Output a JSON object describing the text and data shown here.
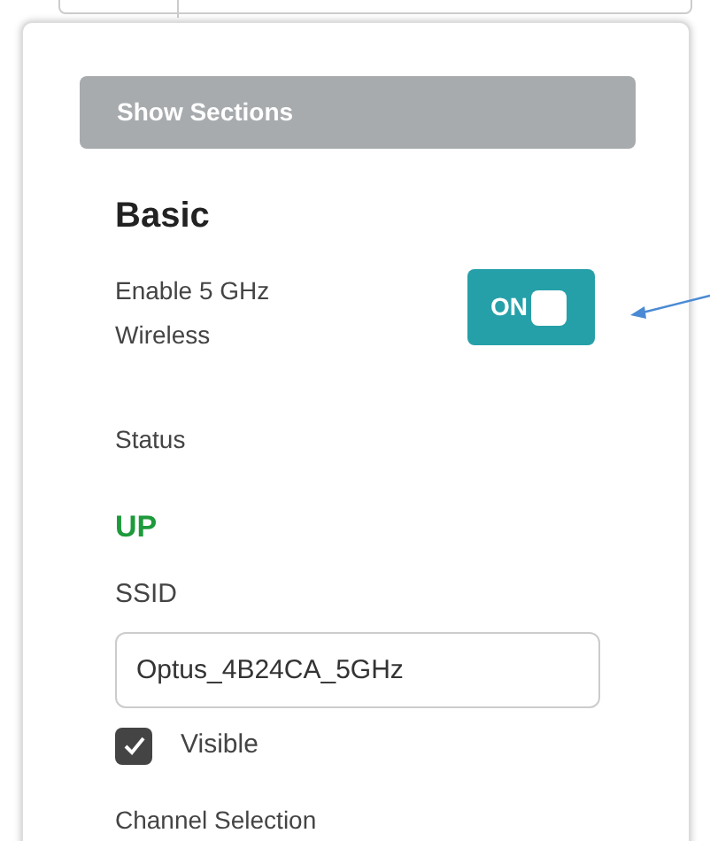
{
  "show_sections_button": {
    "label": "Show Sections"
  },
  "section": {
    "title": "Basic",
    "enable_wireless": {
      "label": "Enable 5 GHz Wireless",
      "toggle_label": "ON",
      "on": true
    },
    "status": {
      "label": "Status",
      "value": "UP"
    },
    "ssid": {
      "label": "SSID",
      "value": "Optus_4B24CA_5GHz"
    },
    "visible": {
      "label": "Visible",
      "checked": true
    },
    "channel_selection": {
      "label": "Channel Selection"
    }
  }
}
